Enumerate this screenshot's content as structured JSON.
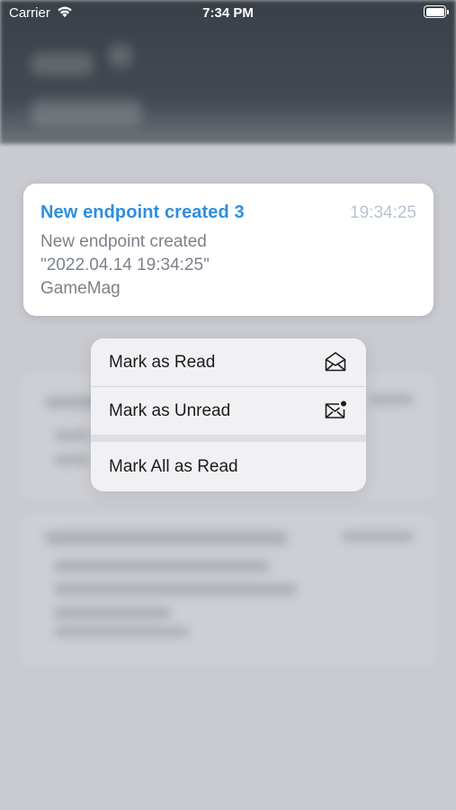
{
  "status_bar": {
    "carrier": "Carrier",
    "time": "7:34 PM",
    "wifi_icon": "wifi-icon",
    "battery_icon": "battery-full-icon"
  },
  "notification": {
    "title": "New endpoint created 3",
    "time": "19:34:25",
    "body_lines": [
      "New endpoint created",
      "\"2022.04.14 19:34:25\"",
      "GameMag"
    ]
  },
  "context_menu": {
    "items": [
      {
        "label": "Mark as Read",
        "icon": "envelope-open-icon"
      },
      {
        "label": "Mark as Unread",
        "icon": "envelope-unread-icon"
      },
      {
        "label": "Mark All as Read"
      }
    ]
  },
  "colors": {
    "title_blue": "#2f8ee0",
    "time_gray": "#b7c3d1",
    "body_gray": "#7c828a",
    "menu_bg": "#f1f1f3",
    "backdrop": "#c9cbd1",
    "header_dark": "#3a4047"
  }
}
